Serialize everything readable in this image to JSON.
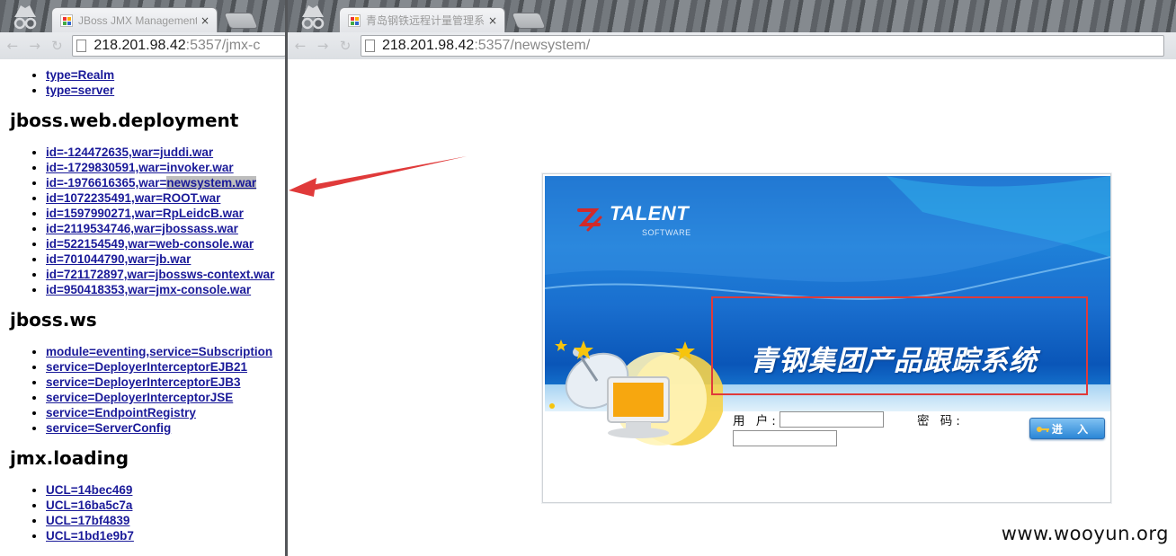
{
  "left_window": {
    "tab_title": "JBoss JMX Management",
    "tab_close": "×",
    "url_host": "218.201.98.42",
    "url_path": ":5357/jmx-c",
    "top_links": [
      "type=Realm",
      "type=server"
    ],
    "sections": [
      {
        "heading": "jboss.web.deployment",
        "items": [
          "id=-124472635,war=juddi.war",
          "id=-1729830591,war=invoker.war",
          "id=-1976616365,war=",
          "id=1072235491,war=ROOT.war",
          "id=1597990271,war=RpLeidcB.war",
          "id=2119534746,war=jbossass.war",
          "id=522154549,war=web-console.war",
          "id=701044790,war=jb.war",
          "id=721172897,war=jbossws-context.war",
          "id=950418353,war=jmx-console.war"
        ],
        "highlight_suffix": "newsystem.war"
      },
      {
        "heading": "jboss.ws",
        "items": [
          "module=eventing,service=Subscription",
          "service=DeployerInterceptorEJB21",
          "service=DeployerInterceptorEJB3",
          "service=DeployerInterceptorJSE",
          "service=EndpointRegistry",
          "service=ServerConfig"
        ]
      },
      {
        "heading": "jmx.loading",
        "items": [
          "UCL=14bec469",
          "UCL=16ba5c7a",
          "UCL=17bf4839",
          "UCL=1bd1e9b7"
        ]
      }
    ]
  },
  "right_window": {
    "tab_title": "青岛钢铁远程计量管理系",
    "tab_close": "×",
    "url_host": "218.201.98.42",
    "url_path": ":5357/newsystem/",
    "login": {
      "logo_text": "TALENT",
      "logo_sub": "SOFTWARE",
      "system_title": "青钢集团产品跟踪系统",
      "user_label": "用 户:",
      "password_label": "密 码:",
      "user_value": "",
      "password_value": "",
      "enter_button": "进 入"
    }
  },
  "watermark": "www.wooyun.org",
  "colors": {
    "link": "#1a1a99",
    "highlight": "#bdbdbd",
    "annotation_red": "#e03a3a",
    "banner_blue": "#0d63c4"
  }
}
